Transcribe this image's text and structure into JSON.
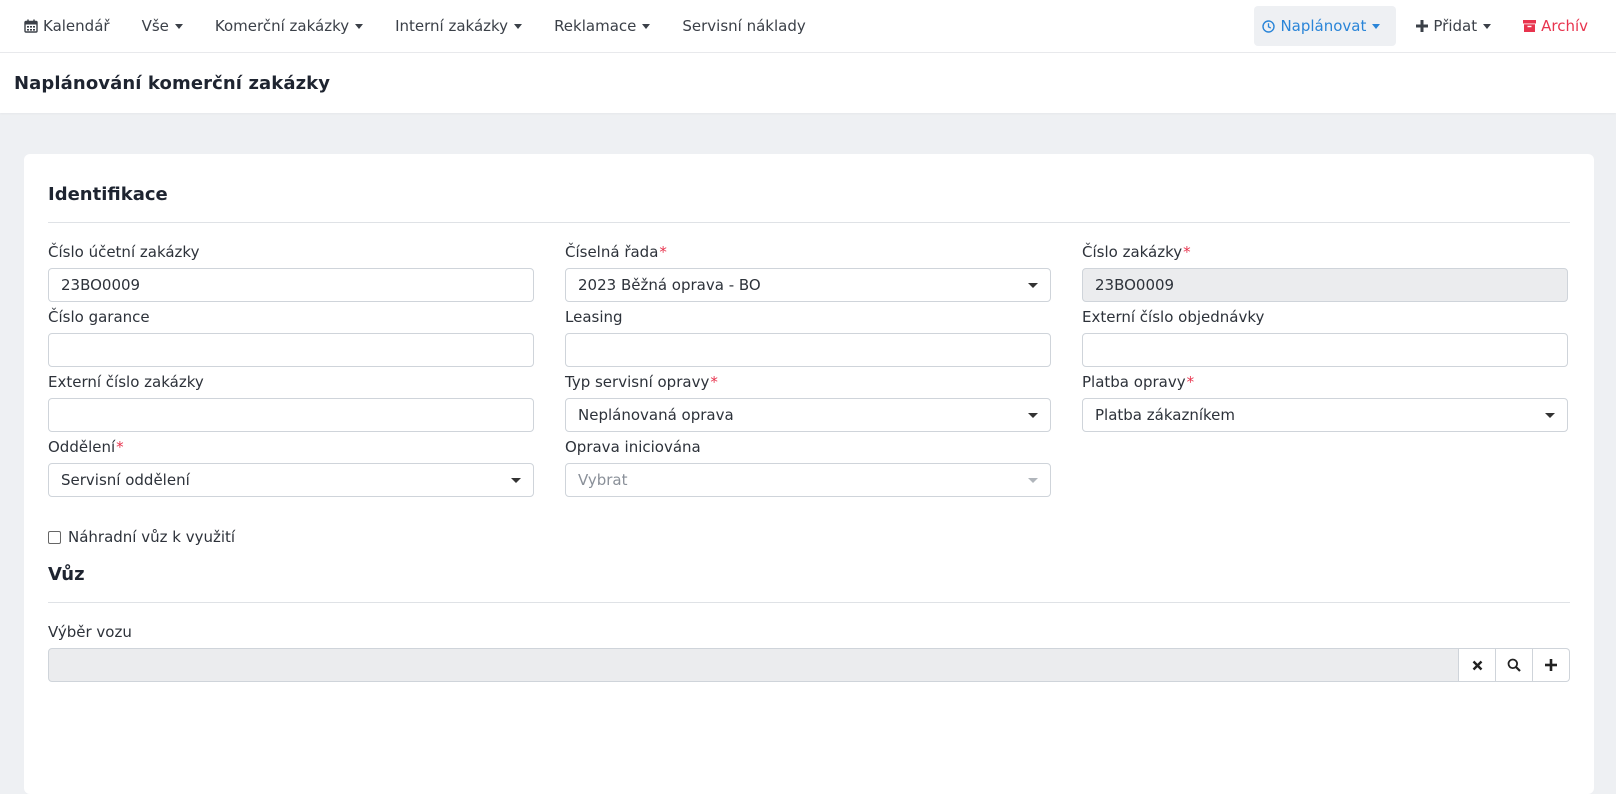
{
  "nav": {
    "calendar": "Kalendář",
    "all": "Vše",
    "commercial": "Komerční zakázky",
    "internal": "Interní zakázky",
    "complaints": "Reklamace",
    "service_costs": "Servisní náklady",
    "plan": "Naplánovat",
    "add": "Přidat",
    "archive": "Archív"
  },
  "page": {
    "title": "Naplánování komerční zakázky"
  },
  "identification": {
    "title": "Identifikace",
    "accounting_order_number": {
      "label": "Číslo účetní zakázky",
      "value": "23BO0009"
    },
    "number_series": {
      "label": "Číselná řada",
      "value": "2023 Běžná oprava - BO"
    },
    "order_number": {
      "label": "Číslo zakázky",
      "value": "23BO0009"
    },
    "warranty_number": {
      "label": "Číslo garance",
      "value": ""
    },
    "leasing": {
      "label": "Leasing",
      "value": ""
    },
    "external_po_number": {
      "label": "Externí číslo objednávky",
      "value": ""
    },
    "external_order_number": {
      "label": "Externí číslo zakázky",
      "value": ""
    },
    "service_repair_type": {
      "label": "Typ servisní opravy",
      "value": "Neplánovaná oprava"
    },
    "repair_payment": {
      "label": "Platba opravy",
      "value": "Platba zákazníkem"
    },
    "department": {
      "label": "Oddělení",
      "value": "Servisní oddělení"
    },
    "repair_initiated": {
      "label": "Oprava iniciována",
      "placeholder": "Vybrat"
    },
    "replacement_car": {
      "label": "Náhradní vůz k využití",
      "checked": false
    }
  },
  "car": {
    "title": "Vůz",
    "selection": {
      "label": "Výběr vozu",
      "value": ""
    }
  },
  "colors": {
    "accent": "#2a85d8",
    "danger": "#e8344e",
    "required": "#e8344e"
  }
}
